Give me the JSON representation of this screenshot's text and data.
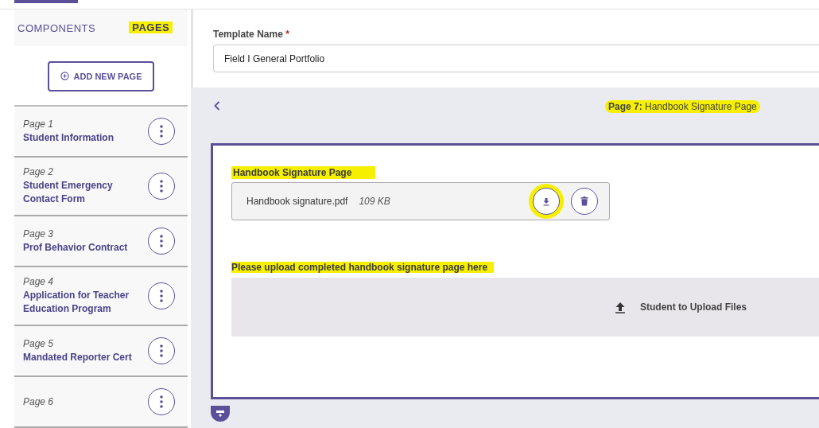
{
  "sidebar": {
    "tabs": [
      {
        "label": "COMPONENTS",
        "selected": false,
        "highlighted": false
      },
      {
        "label": "PAGES",
        "selected": true,
        "highlighted": true
      }
    ],
    "add_button": {
      "label": "ADD NEW PAGE"
    },
    "pages": [
      {
        "number": "Page 1",
        "name": "Student Information"
      },
      {
        "number": "Page 2",
        "name": "Student Emergency Contact Form"
      },
      {
        "number": "Page 3",
        "name": "Prof Behavior Contract"
      },
      {
        "number": "Page 4",
        "name": "Application for Teacher Education Program"
      },
      {
        "number": "Page 5",
        "name": "Mandated Reporter Cert"
      },
      {
        "number": "Page 6"
      }
    ]
  },
  "template_name": {
    "label": "Template Name",
    "required_mark": "*",
    "value": "Field I General Portfolio"
  },
  "page_header": {
    "prefix": "Page 7:",
    "title": "Handbook Signature Page",
    "highlighted": true
  },
  "card": {
    "attachment_label": "Handbook Signature Page",
    "attachment_label_highlighted": true,
    "attachment": {
      "file_name": "Handbook signature.pdf",
      "size": "109 KB",
      "download_circled": true
    },
    "upload_label": "Please upload completed handbook signature page here",
    "upload_label_highlighted": true,
    "upload_button": "Student to Upload Files"
  }
}
